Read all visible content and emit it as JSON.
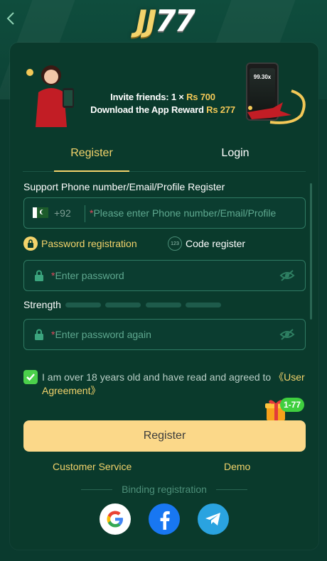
{
  "header": {
    "back_icon": "chevron-left-icon",
    "logo_jj": "JJ",
    "logo_77": "77"
  },
  "banner": {
    "line1_prefix": "Invite friends: 1 × ",
    "line1_amount": "Rs 700",
    "line2_prefix": "Download the App Reward ",
    "line2_amount": "Rs 277",
    "phone_screen": "99.30x"
  },
  "tabs": {
    "register": "Register",
    "login": "Login"
  },
  "form": {
    "support_text": "Support Phone number/Email/Profile Register",
    "country_code": "+92",
    "phone_placeholder": "Please enter Phone number/Email/Profile",
    "required_mark": "*",
    "option_password": "Password registration",
    "option_code": "Code register",
    "code_badge": "123",
    "password_placeholder": "Enter password",
    "strength_label": "Strength",
    "password_again_placeholder": "Enter password again",
    "agree_text": "I am over 18 years old and have read and agreed to ",
    "agree_link": "《User Agreement》",
    "gift_badge": "1-77",
    "register_button": "Register"
  },
  "footer": {
    "customer_service": "Customer Service",
    "demo": "Demo",
    "binding_label": "Binding registration"
  },
  "colors": {
    "background": "#0a3a2e",
    "accent_gold": "#f3d36b",
    "button": "#fbd889",
    "check_green": "#4bd04b"
  }
}
